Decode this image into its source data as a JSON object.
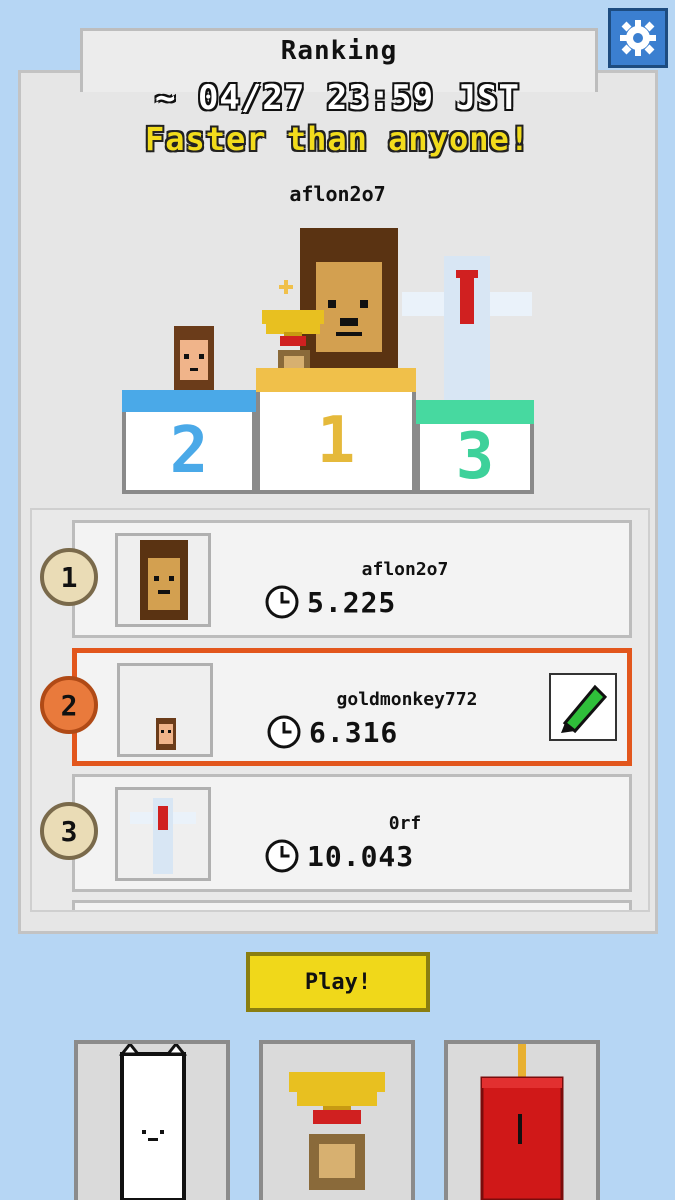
{
  "header": {
    "title": "Ranking",
    "deadline": "~ 04/27 23:59 JST",
    "tagline": "Faster than anyone!",
    "winner_name": "aflon2o7"
  },
  "podium": {
    "second": "2",
    "first": "1",
    "third": "3"
  },
  "ranking": [
    {
      "rank": "1",
      "name": "aflon2o7",
      "time": "5.225",
      "is_me": false
    },
    {
      "rank": "2",
      "name": "goldmonkey772",
      "time": "6.316",
      "is_me": true
    },
    {
      "rank": "3",
      "name": "0rf",
      "time": "10.043",
      "is_me": false
    }
  ],
  "play_button": "Play!",
  "icons": {
    "settings": "gear-icon",
    "clock": "clock-icon",
    "edit": "pencil-icon",
    "nav": [
      "cat-icon",
      "trophy-icon",
      "drink-can-icon"
    ]
  },
  "colors": {
    "background": "#b6d6f4",
    "highlight": "#e2561c",
    "tagline": "#f2dc1c",
    "play": "#f0d81a"
  }
}
